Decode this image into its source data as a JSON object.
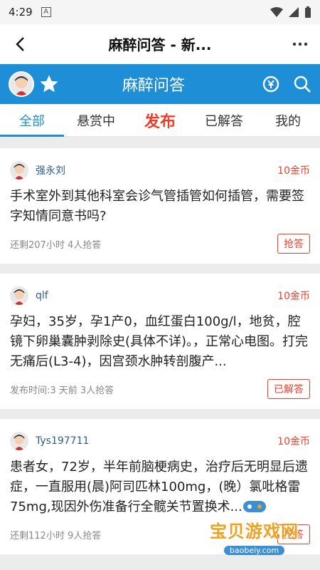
{
  "status": {
    "time": "4:29",
    "indicator": "A"
  },
  "appbar": {
    "title": "麻醉问答 - 新..."
  },
  "header": {
    "title": "麻醉问答"
  },
  "tabs": [
    {
      "label": "全部"
    },
    {
      "label": "悬赏中"
    },
    {
      "label": "发布"
    },
    {
      "label": "已解答"
    },
    {
      "label": "我的"
    }
  ],
  "questions": [
    {
      "user": "强永刘",
      "reward": "10金币",
      "text": "手术室外到其他科室会诊气管插管如何插管，需要签字知情同意书吗?",
      "meta": "还剩207小时 4人抢答",
      "action": "抢答"
    },
    {
      "user": "qlf",
      "reward": "10金币",
      "text": "孕妇，35岁，孕1产0，血红蛋白100g/l，地贫，腔镜下卵巢囊肿剥除史(具体不详)。，正常心电图。打完无痛后(L3-4)，因宫颈水肿转剖腹产...",
      "meta": "发布时间:3 天前 3人抢答",
      "action": "已解答"
    },
    {
      "user": "Tys197711",
      "reward": "10金币",
      "text": "患者女，72岁，半年前脑梗病史，治疗后无明显后遗症，一直服用(晨)阿司匹林100mg，(晚）氯吡格雷75mg,现因外伤准备行全髋关节置换术...",
      "meta": "还剩112小时 9人抢答",
      "action": "抢答"
    }
  ],
  "watermark": {
    "text": "宝贝游戏网",
    "url": "baobeiy.com"
  },
  "colors": {
    "primary": "#1e8fd6",
    "accent": "#e8402f"
  }
}
